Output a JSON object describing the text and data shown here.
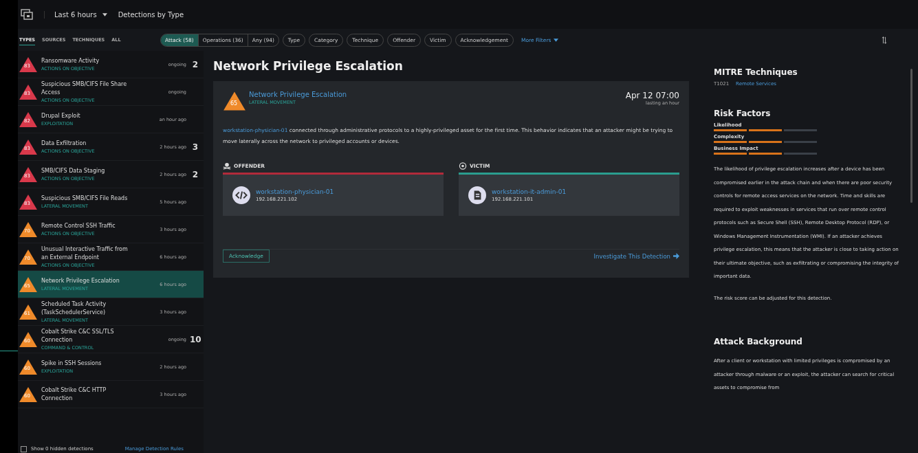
{
  "header": {
    "time_range": "Last 6 hours",
    "view": "Detections by Type"
  },
  "tabs": [
    {
      "label": "TYPES",
      "selected": true
    },
    {
      "label": "SOURCES",
      "selected": false
    },
    {
      "label": "TECHNIQUES",
      "selected": false
    },
    {
      "label": "ALL",
      "selected": false
    }
  ],
  "segments": [
    {
      "label": "Attack (58)",
      "selected": true
    },
    {
      "label": "Operations (36)",
      "selected": false
    },
    {
      "label": "Any (94)",
      "selected": false
    }
  ],
  "filters": [
    "Type",
    "Category",
    "Technique",
    "Offender",
    "Victim",
    "Acknowledgement"
  ],
  "more_filters": "More Filters",
  "detections": [
    {
      "score": "83",
      "color": "#d9394b",
      "title": "Ransomware Activity",
      "category": "ACTIONS ON OBJECTIVE",
      "time": "ongoing",
      "count": "2",
      "selected": false
    },
    {
      "score": "83",
      "color": "#d9394b",
      "title": "Suspicious SMB/CIFS File Share Access",
      "category": "ACTIONS ON OBJECTIVE",
      "time": "ongoing",
      "selected": false
    },
    {
      "score": "82",
      "color": "#d9394b",
      "title": "Drupal Exploit",
      "category": "EXPLOITATION",
      "time": "an hour ago",
      "selected": false
    },
    {
      "score": "83",
      "color": "#d9394b",
      "title": "Data Exfiltration",
      "category": "ACTIONS ON OBJECTIVE",
      "time": "2 hours ago",
      "count": "3",
      "selected": false
    },
    {
      "score": "83",
      "color": "#d9394b",
      "title": "SMB/CIFS Data Staging",
      "category": "ACTIONS ON OBJECTIVE",
      "time": "2 hours ago",
      "count": "2",
      "selected": false
    },
    {
      "score": "83",
      "color": "#d9394b",
      "title": "Suspicious SMB/CIFS File Reads",
      "category": "LATERAL MOVEMENT",
      "time": "5 hours ago",
      "selected": false
    },
    {
      "score": "70",
      "color": "#ef8a2a",
      "title": "Remote Control SSH Traffic",
      "category": "ACTIONS ON OBJECTIVE",
      "time": "3 hours ago",
      "selected": false
    },
    {
      "score": "70",
      "color": "#ef8a2a",
      "title": "Unusual Interactive Traffic from an External Endpoint",
      "category": "ACTIONS ON OBJECTIVE",
      "time": "6 hours ago",
      "selected": false
    },
    {
      "score": "65",
      "color": "#ef8a2a",
      "title": "Network Privilege Escalation",
      "category": "LATERAL MOVEMENT",
      "time": "6 hours ago",
      "selected": true
    },
    {
      "score": "61",
      "color": "#ef8a2a",
      "title": "Scheduled Task Activity (TaskSchedulerService)",
      "category": "LATERAL MOVEMENT",
      "time": "3 hours ago",
      "selected": false
    },
    {
      "score": "60",
      "color": "#ef8a2a",
      "title": "Cobalt Strike C&C SSL/TLS Connection",
      "category": "COMMAND & CONTROL",
      "time": "ongoing",
      "count": "10",
      "selected": false
    },
    {
      "score": "60",
      "color": "#ef8a2a",
      "title": "Spike in SSH Sessions",
      "category": "EXPLOITATION",
      "time": "2 hours ago",
      "selected": false
    },
    {
      "score": "60",
      "color": "#ef8a2a",
      "title": "Cobalt Strike C&C HTTP Connection",
      "time": "3 hours ago",
      "selected": false
    }
  ],
  "footer": {
    "hidden_label": "Show 0 hidden detections",
    "checked": false,
    "manage_link": "Manage Detection Rules"
  },
  "detail": {
    "heading": "Network Privilege Escalation",
    "score": "65",
    "color": "#ef8a2a",
    "title": "Network Privilege Escalation",
    "category": "LATERAL MOVEMENT",
    "date": "Apr 12 07:00",
    "duration": "lasting an hour",
    "description_link": "workstation-physician-01",
    "description": "connected through administrative protocols to a highly-privileged asset for the first time. This behavior indicates that an attacker might be trying to move laterally across the network to privileged accounts or devices.",
    "offender": {
      "label": "OFFENDER",
      "host": "workstation-physician-01",
      "ip": "192.168.221.102"
    },
    "victim": {
      "label": "VICTIM",
      "host": "workstation-it-admin-01",
      "ip": "192.168.221.101"
    },
    "acknowledge": "Acknowledge",
    "investigate": "Investigate This Detection"
  },
  "side": {
    "mitre_title": "MITRE Techniques",
    "technique_id": "T1021",
    "technique_name": "Remote Services",
    "risk_title": "Risk Factors",
    "risks": [
      {
        "label": "Likelihood",
        "level": 0.67
      },
      {
        "label": "Complexity",
        "level": 0.67
      },
      {
        "label": "Business Impact",
        "level": 0.67
      }
    ],
    "paragraphs": [
      "The likelihood of privilege escalation increases after a device has been compromised earlier in the attack chain and when there are poor security controls for remote access services on the network. Time and skills are required to exploit weaknesses in services that run over remote control protocols such as Secure Shell (SSH), Remote Desktop Protocol (RDP), or Windows Management Instrumentation (WMI). If an attacker achieves privilege escalation, this means that the attacker is close to taking action on their ultimate objective, such as exfiltrating or compromising the integrity of important data.",
      "The risk score can be adjusted for this detection."
    ],
    "background_title": "Attack Background",
    "background": "After a client or workstation with limited privileges is compromised by an attacker through malware or an exploit, the attacker can search for critical assets to compromise from"
  }
}
